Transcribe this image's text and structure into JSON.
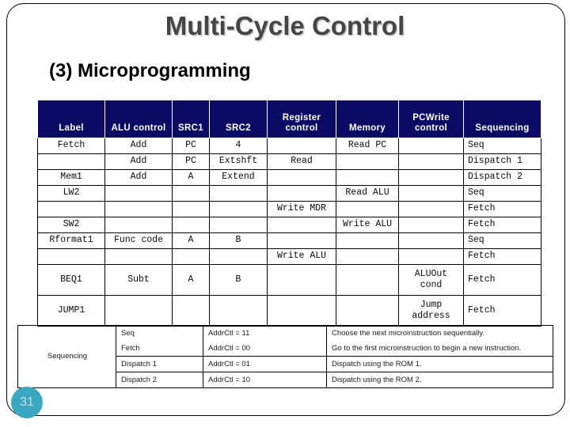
{
  "slide": {
    "title": "Multi-Cycle Control",
    "subtitle": "(3) Microprogramming",
    "page_number": "31",
    "colors": {
      "header_bg": "#0b0b66",
      "title_text": "#454545",
      "badge_bg": "#3aa8c1",
      "badge_text": "#bfe4ee"
    }
  },
  "micro_table": {
    "headers": [
      "Label",
      "ALU\ncontrol",
      "SRC1",
      "SRC2",
      "Register\ncontrol",
      "Memory",
      "PCWrite\ncontrol",
      "Sequencing"
    ],
    "rows": [
      {
        "label": "Fetch",
        "alu": "Add",
        "src1": "PC",
        "src2": "4",
        "reg": "",
        "mem": "Read PC",
        "pcwrite": "",
        "seq": "Seq",
        "tall": false
      },
      {
        "label": "",
        "alu": "Add",
        "src1": "PC",
        "src2": "Extshft",
        "reg": "Read",
        "mem": "",
        "pcwrite": "",
        "seq": "Dispatch 1",
        "tall": false
      },
      {
        "label": "Mem1",
        "alu": "Add",
        "src1": "A",
        "src2": "Extend",
        "reg": "",
        "mem": "",
        "pcwrite": "",
        "seq": "Dispatch 2",
        "tall": false
      },
      {
        "label": "LW2",
        "alu": "",
        "src1": "",
        "src2": "",
        "reg": "",
        "mem": "Read ALU",
        "pcwrite": "",
        "seq": "Seq",
        "tall": false
      },
      {
        "label": "",
        "alu": "",
        "src1": "",
        "src2": "",
        "reg": "Write MDR",
        "mem": "",
        "pcwrite": "",
        "seq": "Fetch",
        "tall": false
      },
      {
        "label": "SW2",
        "alu": "",
        "src1": "",
        "src2": "",
        "reg": "",
        "mem": "Write ALU",
        "pcwrite": "",
        "seq": "Fetch",
        "tall": false
      },
      {
        "label": "Rformat1",
        "alu": "Func code",
        "src1": "A",
        "src2": "B",
        "reg": "",
        "mem": "",
        "pcwrite": "",
        "seq": "Seq",
        "tall": false
      },
      {
        "label": "",
        "alu": "",
        "src1": "",
        "src2": "",
        "reg": "Write ALU",
        "mem": "",
        "pcwrite": "",
        "seq": "Fetch",
        "tall": false
      },
      {
        "label": "BEQ1",
        "alu": "Subt",
        "src1": "A",
        "src2": "B",
        "reg": "",
        "mem": "",
        "pcwrite": "ALUOut\ncond",
        "seq": "Fetch",
        "tall": true
      },
      {
        "label": "JUMP1",
        "alu": "",
        "src1": "",
        "src2": "",
        "reg": "",
        "mem": "",
        "pcwrite": "Jump\naddress",
        "seq": "Fetch",
        "tall": true
      }
    ]
  },
  "seq_legend": {
    "row_label": "Sequencing",
    "rows": [
      {
        "name": "Seq",
        "addrctl": "AddrCtl = 11",
        "desc": "Choose the next microinstruction sequentially."
      },
      {
        "name": "Fetch",
        "addrctl": "AddrCtl = 00",
        "desc": "Go to the first microinstruction to begin a new instruction."
      },
      {
        "name": "Dispatch 1",
        "addrctl": "AddrCtl = 01",
        "desc": "Dispatch using the ROM 1."
      },
      {
        "name": "Dispatch 2",
        "addrctl": "AddrCtl = 10",
        "desc": "Dispatch using the ROM 2."
      }
    ]
  }
}
